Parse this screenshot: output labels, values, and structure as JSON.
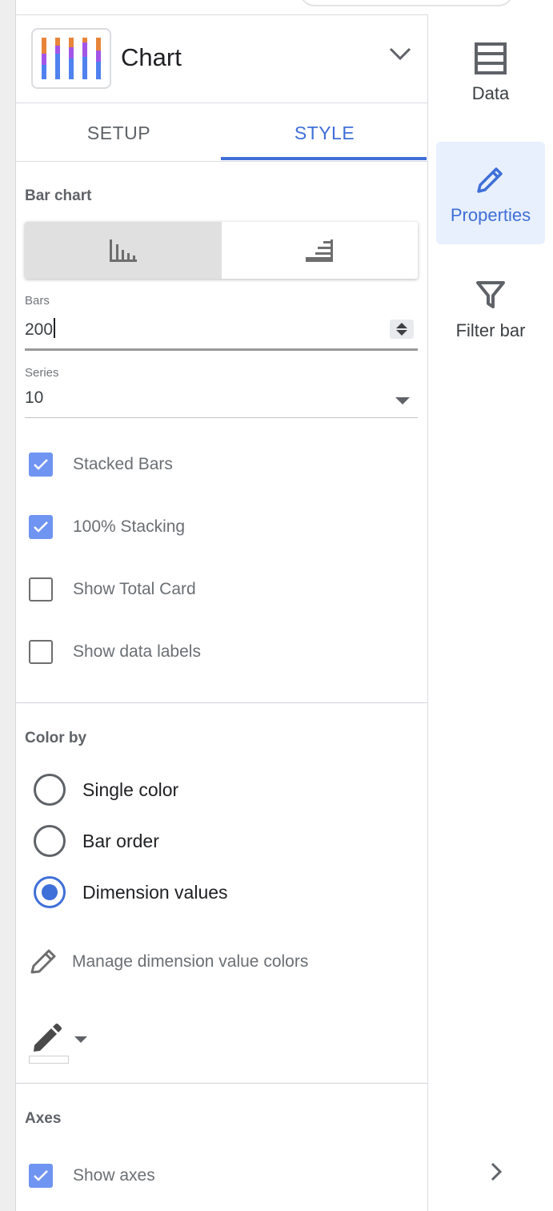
{
  "chart_picker": {
    "title": "Chart",
    "thumb_colors": [
      "#e8853a",
      "#a355e8",
      "#4f82ef"
    ],
    "expand_icon": "chevron-down-icon"
  },
  "tabs": [
    {
      "label": "SETUP",
      "active": false
    },
    {
      "label": "STYLE",
      "active": true
    }
  ],
  "bar_chart": {
    "section_title": "Bar chart",
    "orientation": {
      "selected": "vertical",
      "options": [
        "vertical-bars-icon",
        "horizontal-bars-icon"
      ]
    },
    "bars": {
      "label": "Bars",
      "value": "200"
    },
    "series": {
      "label": "Series",
      "value": "10"
    },
    "checkboxes": [
      {
        "label": "Stacked Bars",
        "checked": true
      },
      {
        "label": "100% Stacking",
        "checked": true
      },
      {
        "label": "Show Total Card",
        "checked": false
      },
      {
        "label": "Show data labels",
        "checked": false
      }
    ]
  },
  "color_by": {
    "section_title": "Color by",
    "options": [
      {
        "label": "Single color",
        "selected": false
      },
      {
        "label": "Bar order",
        "selected": false
      },
      {
        "label": "Dimension values",
        "selected": true
      }
    ],
    "manage_label": "Manage dimension value colors"
  },
  "axes": {
    "section_title": "Axes",
    "show_axes": {
      "label": "Show axes",
      "checked": true
    }
  },
  "rail": {
    "items": [
      {
        "label": "Data",
        "icon": "database-icon",
        "active": false
      },
      {
        "label": "Properties",
        "icon": "pencil-icon",
        "active": true
      },
      {
        "label": "Filter bar",
        "icon": "filter-icon",
        "active": false
      }
    ],
    "next_icon": "chevron-right-icon"
  },
  "colors": {
    "accent": "#3f6fd8",
    "checkbox_fill": "#6f94f2",
    "active_rail_bg": "#e8f0fe"
  }
}
